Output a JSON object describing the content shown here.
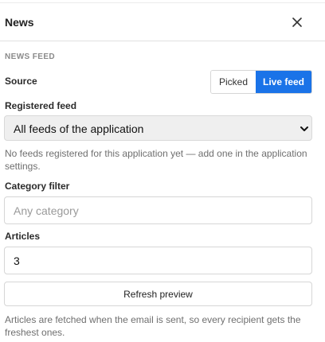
{
  "header": {
    "title": "News",
    "close_icon": "close-icon"
  },
  "section": {
    "title": "NEWS FEED"
  },
  "source": {
    "label": "Source",
    "options": [
      "Picked",
      "Live feed"
    ],
    "selected": "Live feed",
    "accent_color": "#1a73e8"
  },
  "registered_feed": {
    "label": "Registered feed",
    "selected": "All feeds of the application",
    "chevron_icon": "chevron-down-icon",
    "help": "No feeds registered for this application yet — add one in the application settings."
  },
  "category_filter": {
    "label": "Category filter",
    "value": "",
    "placeholder": "Any category"
  },
  "articles": {
    "label": "Articles",
    "value": "3"
  },
  "refresh": {
    "label": "Refresh preview",
    "help": "Articles are fetched when the email is sent, so every recipient gets the freshest ones."
  }
}
